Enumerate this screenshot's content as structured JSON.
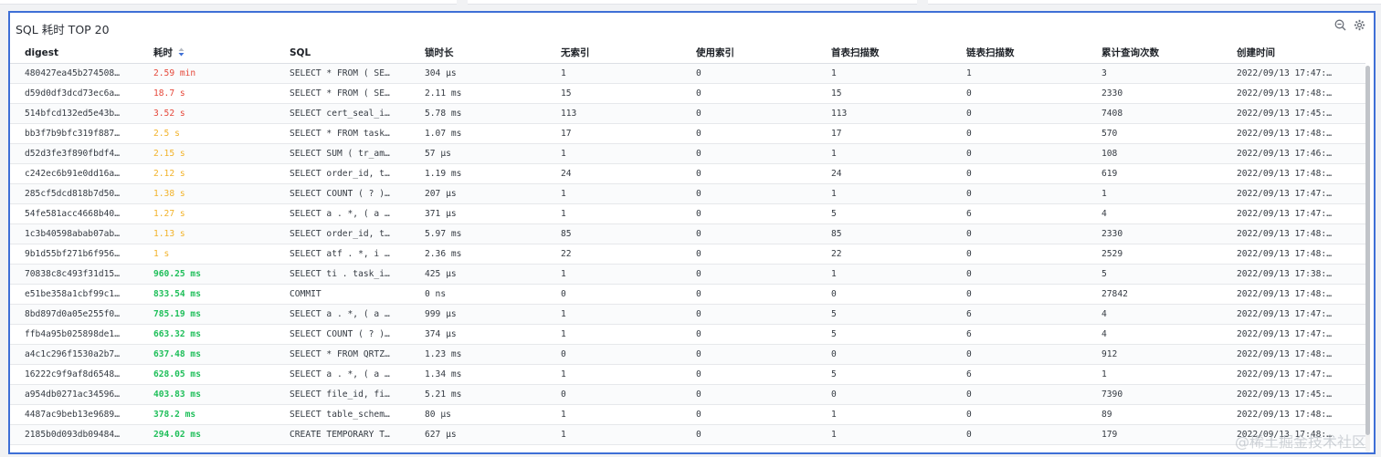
{
  "panel": {
    "title": "SQL 耗时 TOP 20"
  },
  "icons": {
    "zoom_out": "zoom-out-icon",
    "settings": "gear-icon",
    "sort": "sort-icon"
  },
  "colors": {
    "accent_border": "#3e6fd6",
    "slow_red": "#e5483a",
    "medium_orange": "#f2b32a",
    "fast_green": "#1fbf5a"
  },
  "table": {
    "columns": [
      "digest",
      "耗时",
      "SQL",
      "锁时长",
      "无索引",
      "使用索引",
      "首表扫描数",
      "链表扫描数",
      "累计查询次数",
      "创建时间"
    ],
    "rows": [
      {
        "digest": "480427ea45b274508…",
        "duration": "2.59 min",
        "level": "red",
        "sql": "SELECT * FROM ( SE…",
        "lock": "304 μs",
        "noidx": "1",
        "useidx": "0",
        "first": "1",
        "join": "1",
        "count": "3",
        "created": "2022/09/13 17:47:…"
      },
      {
        "digest": "d59d0df3dcd73ec6a…",
        "duration": "18.7 s",
        "level": "red",
        "sql": "SELECT * FROM ( SE…",
        "lock": "2.11 ms",
        "noidx": "15",
        "useidx": "0",
        "first": "15",
        "join": "0",
        "count": "2330",
        "created": "2022/09/13 17:48:…"
      },
      {
        "digest": "514bfcd132ed5e43b…",
        "duration": "3.52 s",
        "level": "red",
        "sql": "SELECT cert_seal_i…",
        "lock": "5.78 ms",
        "noidx": "113",
        "useidx": "0",
        "first": "113",
        "join": "0",
        "count": "7408",
        "created": "2022/09/13 17:45:…"
      },
      {
        "digest": "bb3f7b9bfc319f887…",
        "duration": "2.5 s",
        "level": "orange",
        "sql": "SELECT * FROM task…",
        "lock": "1.07 ms",
        "noidx": "17",
        "useidx": "0",
        "first": "17",
        "join": "0",
        "count": "570",
        "created": "2022/09/13 17:48:…"
      },
      {
        "digest": "d52d3fe3f890fbdf4…",
        "duration": "2.15 s",
        "level": "orange",
        "sql": "SELECT SUM ( tr_am…",
        "lock": "57 μs",
        "noidx": "1",
        "useidx": "0",
        "first": "1",
        "join": "0",
        "count": "108",
        "created": "2022/09/13 17:46:…"
      },
      {
        "digest": "c242ec6b91e0dd16a…",
        "duration": "2.12 s",
        "level": "orange",
        "sql": "SELECT order_id, t…",
        "lock": "1.19 ms",
        "noidx": "24",
        "useidx": "0",
        "first": "24",
        "join": "0",
        "count": "619",
        "created": "2022/09/13 17:48:…"
      },
      {
        "digest": "285cf5dcd818b7d50…",
        "duration": "1.38 s",
        "level": "orange",
        "sql": "SELECT COUNT ( ? )…",
        "lock": "207 μs",
        "noidx": "1",
        "useidx": "0",
        "first": "1",
        "join": "0",
        "count": "1",
        "created": "2022/09/13 17:47:…"
      },
      {
        "digest": "54fe581acc4668b40…",
        "duration": "1.27 s",
        "level": "orange",
        "sql": "SELECT a . *, ( a …",
        "lock": "371 μs",
        "noidx": "1",
        "useidx": "0",
        "first": "5",
        "join": "6",
        "count": "4",
        "created": "2022/09/13 17:47:…"
      },
      {
        "digest": "1c3b40598abab07ab…",
        "duration": "1.13 s",
        "level": "orange",
        "sql": "SELECT order_id, t…",
        "lock": "5.97 ms",
        "noidx": "85",
        "useidx": "0",
        "first": "85",
        "join": "0",
        "count": "2330",
        "created": "2022/09/13 17:48:…"
      },
      {
        "digest": "9b1d55bf271b6f956…",
        "duration": "1 s",
        "level": "orange",
        "sql": "SELECT atf . *, i …",
        "lock": "2.36 ms",
        "noidx": "22",
        "useidx": "0",
        "first": "22",
        "join": "0",
        "count": "2529",
        "created": "2022/09/13 17:48:…"
      },
      {
        "digest": "70838c8c493f31d15…",
        "duration": "960.25 ms",
        "level": "green",
        "sql": "SELECT ti . task_i…",
        "lock": "425 μs",
        "noidx": "1",
        "useidx": "0",
        "first": "1",
        "join": "0",
        "count": "5",
        "created": "2022/09/13 17:38:…"
      },
      {
        "digest": "e51be358a1cbf99c1…",
        "duration": "833.54 ms",
        "level": "green",
        "sql": "COMMIT",
        "lock": "0 ns",
        "noidx": "0",
        "useidx": "0",
        "first": "0",
        "join": "0",
        "count": "27842",
        "created": "2022/09/13 17:48:…"
      },
      {
        "digest": "8bd897d0a05e255f0…",
        "duration": "785.19 ms",
        "level": "green",
        "sql": "SELECT a . *, ( a …",
        "lock": "999 μs",
        "noidx": "1",
        "useidx": "0",
        "first": "5",
        "join": "6",
        "count": "4",
        "created": "2022/09/13 17:47:…"
      },
      {
        "digest": "ffb4a95b025898de1…",
        "duration": "663.32 ms",
        "level": "green",
        "sql": "SELECT COUNT ( ? )…",
        "lock": "374 μs",
        "noidx": "1",
        "useidx": "0",
        "first": "5",
        "join": "6",
        "count": "4",
        "created": "2022/09/13 17:47:…"
      },
      {
        "digest": "a4c1c296f1530a2b7…",
        "duration": "637.48 ms",
        "level": "green",
        "sql": "SELECT * FROM QRTZ…",
        "lock": "1.23 ms",
        "noidx": "0",
        "useidx": "0",
        "first": "0",
        "join": "0",
        "count": "912",
        "created": "2022/09/13 17:48:…"
      },
      {
        "digest": "16222c9f9af8d6548…",
        "duration": "628.05 ms",
        "level": "green",
        "sql": "SELECT a . *, ( a …",
        "lock": "1.34 ms",
        "noidx": "1",
        "useidx": "0",
        "first": "5",
        "join": "6",
        "count": "1",
        "created": "2022/09/13 17:47:…"
      },
      {
        "digest": "a954db0271ac34596…",
        "duration": "403.83 ms",
        "level": "green",
        "sql": "SELECT file_id, fi…",
        "lock": "5.21 ms",
        "noidx": "0",
        "useidx": "0",
        "first": "0",
        "join": "0",
        "count": "7390",
        "created": "2022/09/13 17:45:…"
      },
      {
        "digest": "4487ac9beb13e9689…",
        "duration": "378.2 ms",
        "level": "green",
        "sql": "SELECT table_schem…",
        "lock": "80 μs",
        "noidx": "1",
        "useidx": "0",
        "first": "1",
        "join": "0",
        "count": "89",
        "created": "2022/09/13 17:48:…"
      },
      {
        "digest": "2185b0d093db09484…",
        "duration": "294.02 ms",
        "level": "green",
        "sql": "CREATE TEMPORARY T…",
        "lock": "627 μs",
        "noidx": "1",
        "useidx": "0",
        "first": "1",
        "join": "0",
        "count": "179",
        "created": "2022/09/13 17:48:…"
      }
    ]
  },
  "watermark": "@稀土掘金技术社区"
}
